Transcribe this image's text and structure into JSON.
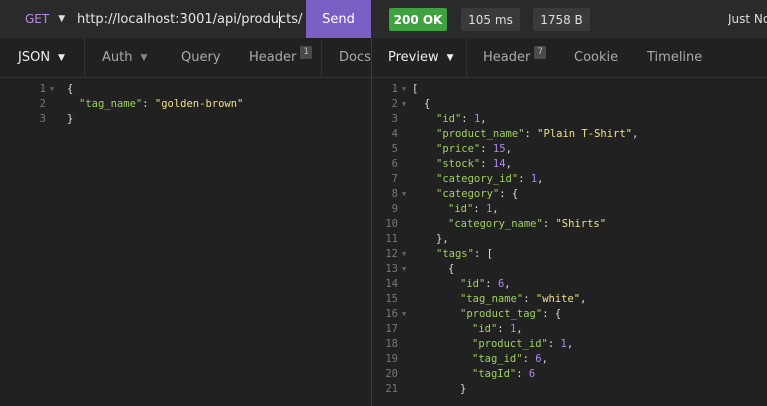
{
  "request": {
    "method": "GET",
    "url": "http://localhost:3001/api/products/",
    "send_label": "Send",
    "tabs": [
      {
        "label": "JSON"
      },
      {
        "label": "Auth"
      },
      {
        "label": "Query"
      },
      {
        "label": "Header",
        "badge": "1"
      },
      {
        "label": "Docs"
      }
    ],
    "body_lines": [
      {
        "n": "1",
        "fold": true,
        "indent": 0,
        "tokens": [
          {
            "t": "p",
            "v": "{"
          }
        ]
      },
      {
        "n": "2",
        "fold": false,
        "indent": 1,
        "tokens": [
          {
            "t": "k",
            "v": "\"tag_name\""
          },
          {
            "t": "p",
            "v": ": "
          },
          {
            "t": "s",
            "v": "\"golden-brown\""
          }
        ]
      },
      {
        "n": "3",
        "fold": false,
        "indent": 0,
        "tokens": [
          {
            "t": "p",
            "v": "}"
          }
        ]
      }
    ]
  },
  "response": {
    "status": "200 OK",
    "time": "105 ms",
    "size": "1758 B",
    "timestamp": "Just No",
    "tabs": [
      {
        "label": "Preview"
      },
      {
        "label": "Header",
        "badge": "7"
      },
      {
        "label": "Cookie"
      },
      {
        "label": "Timeline"
      }
    ],
    "lines": [
      {
        "n": "1",
        "fold": true,
        "indent": 0,
        "tokens": [
          {
            "t": "p",
            "v": "["
          }
        ]
      },
      {
        "n": "2",
        "fold": true,
        "indent": 1,
        "tokens": [
          {
            "t": "p",
            "v": "{"
          }
        ]
      },
      {
        "n": "3",
        "fold": false,
        "indent": 2,
        "tokens": [
          {
            "t": "k",
            "v": "\"id\""
          },
          {
            "t": "p",
            "v": ": "
          },
          {
            "t": "n",
            "v": "1"
          },
          {
            "t": "p",
            "v": ","
          }
        ]
      },
      {
        "n": "4",
        "fold": false,
        "indent": 2,
        "tokens": [
          {
            "t": "k",
            "v": "\"product_name\""
          },
          {
            "t": "p",
            "v": ": "
          },
          {
            "t": "s",
            "v": "\"Plain T-Shirt\""
          },
          {
            "t": "p",
            "v": ","
          }
        ]
      },
      {
        "n": "5",
        "fold": false,
        "indent": 2,
        "tokens": [
          {
            "t": "k",
            "v": "\"price\""
          },
          {
            "t": "p",
            "v": ": "
          },
          {
            "t": "n",
            "v": "15"
          },
          {
            "t": "p",
            "v": ","
          }
        ]
      },
      {
        "n": "6",
        "fold": false,
        "indent": 2,
        "tokens": [
          {
            "t": "k",
            "v": "\"stock\""
          },
          {
            "t": "p",
            "v": ": "
          },
          {
            "t": "n",
            "v": "14"
          },
          {
            "t": "p",
            "v": ","
          }
        ]
      },
      {
        "n": "7",
        "fold": false,
        "indent": 2,
        "tokens": [
          {
            "t": "k",
            "v": "\"category_id\""
          },
          {
            "t": "p",
            "v": ": "
          },
          {
            "t": "n",
            "v": "1"
          },
          {
            "t": "p",
            "v": ","
          }
        ]
      },
      {
        "n": "8",
        "fold": true,
        "indent": 2,
        "tokens": [
          {
            "t": "k",
            "v": "\"category\""
          },
          {
            "t": "p",
            "v": ": {"
          }
        ]
      },
      {
        "n": "9",
        "fold": false,
        "indent": 3,
        "tokens": [
          {
            "t": "k",
            "v": "\"id\""
          },
          {
            "t": "p",
            "v": ": "
          },
          {
            "t": "n",
            "v": "1"
          },
          {
            "t": "p",
            "v": ","
          }
        ]
      },
      {
        "n": "10",
        "fold": false,
        "indent": 3,
        "tokens": [
          {
            "t": "k",
            "v": "\"category_name\""
          },
          {
            "t": "p",
            "v": ": "
          },
          {
            "t": "s",
            "v": "\"Shirts\""
          }
        ]
      },
      {
        "n": "11",
        "fold": false,
        "indent": 2,
        "tokens": [
          {
            "t": "p",
            "v": "},"
          }
        ]
      },
      {
        "n": "12",
        "fold": true,
        "indent": 2,
        "tokens": [
          {
            "t": "k",
            "v": "\"tags\""
          },
          {
            "t": "p",
            "v": ": ["
          }
        ]
      },
      {
        "n": "13",
        "fold": true,
        "indent": 3,
        "tokens": [
          {
            "t": "p",
            "v": "{"
          }
        ]
      },
      {
        "n": "14",
        "fold": false,
        "indent": 4,
        "tokens": [
          {
            "t": "k",
            "v": "\"id\""
          },
          {
            "t": "p",
            "v": ": "
          },
          {
            "t": "n",
            "v": "6"
          },
          {
            "t": "p",
            "v": ","
          }
        ]
      },
      {
        "n": "15",
        "fold": false,
        "indent": 4,
        "tokens": [
          {
            "t": "k",
            "v": "\"tag_name\""
          },
          {
            "t": "p",
            "v": ": "
          },
          {
            "t": "s",
            "v": "\"white\""
          },
          {
            "t": "p",
            "v": ","
          }
        ]
      },
      {
        "n": "16",
        "fold": true,
        "indent": 4,
        "tokens": [
          {
            "t": "k",
            "v": "\"product_tag\""
          },
          {
            "t": "p",
            "v": ": {"
          }
        ]
      },
      {
        "n": "17",
        "fold": false,
        "indent": 5,
        "tokens": [
          {
            "t": "k",
            "v": "\"id\""
          },
          {
            "t": "p",
            "v": ": "
          },
          {
            "t": "n",
            "v": "1"
          },
          {
            "t": "p",
            "v": ","
          }
        ]
      },
      {
        "n": "18",
        "fold": false,
        "indent": 5,
        "tokens": [
          {
            "t": "k",
            "v": "\"product_id\""
          },
          {
            "t": "p",
            "v": ": "
          },
          {
            "t": "n",
            "v": "1"
          },
          {
            "t": "p",
            "v": ","
          }
        ]
      },
      {
        "n": "19",
        "fold": false,
        "indent": 5,
        "tokens": [
          {
            "t": "k",
            "v": "\"tag_id\""
          },
          {
            "t": "p",
            "v": ": "
          },
          {
            "t": "n",
            "v": "6"
          },
          {
            "t": "p",
            "v": ","
          }
        ]
      },
      {
        "n": "20",
        "fold": false,
        "indent": 5,
        "tokens": [
          {
            "t": "k",
            "v": "\"tagId\""
          },
          {
            "t": "p",
            "v": ": "
          },
          {
            "t": "n",
            "v": "6"
          }
        ]
      },
      {
        "n": "21",
        "fold": false,
        "indent": 4,
        "tokens": [
          {
            "t": "p",
            "v": "}"
          }
        ]
      }
    ]
  },
  "colors": {
    "send": "#7a5fc4",
    "status_ok": "#3fa13f",
    "method": "#b58be0",
    "key": "#9fd160",
    "string": "#f0e08a",
    "number": "#b089e8"
  }
}
